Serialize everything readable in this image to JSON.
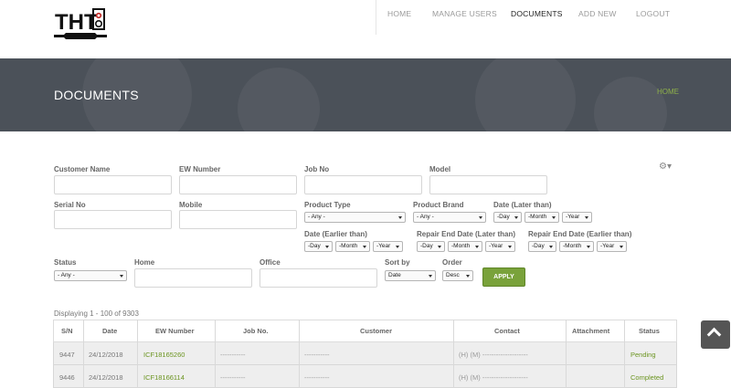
{
  "logo": {
    "text": "THT",
    "tagline": "THE HOME TECH"
  },
  "nav": {
    "home": "HOME",
    "manage_users": "MANAGE USERS",
    "documents": "DOCUMENTS",
    "add_new": "ADD NEW",
    "logout": "LOGOUT"
  },
  "hero": {
    "title": "DOCUMENTS",
    "breadcrumb": "HOME"
  },
  "filters": {
    "customer_name": "Customer Name",
    "ew_number": "EW Number",
    "job_no": "Job No",
    "model": "Model",
    "serial_no": "Serial No",
    "mobile": "Mobile",
    "product_type": {
      "label": "Product Type",
      "value": "- Any -"
    },
    "product_brand": {
      "label": "Product Brand",
      "value": "- Any -"
    },
    "date_later": {
      "label": "Date (Later than)",
      "day": "-Day",
      "month": "-Month",
      "year": "-Year"
    },
    "date_earlier": {
      "label": "Date (Earlier than)",
      "day": "-Day",
      "month": "-Month",
      "year": "-Year"
    },
    "repair_later": {
      "label": "Repair End Date (Later than)",
      "day": "-Day",
      "month": "-Month",
      "year": "-Year"
    },
    "repair_earlier": {
      "label": "Repair End Date (Earlier than)",
      "day": "-Day",
      "month": "-Month",
      "year": "-Year"
    },
    "status": {
      "label": "Status",
      "value": "- Any -"
    },
    "home": "Home",
    "office": "Office",
    "sort_by": {
      "label": "Sort by",
      "value": "Date"
    },
    "order": {
      "label": "Order",
      "value": "Desc"
    },
    "apply_label": "APPLY"
  },
  "display_text": "Displaying 1 - 100 of 9303",
  "table": {
    "headers": [
      "S/N",
      "Date",
      "EW Number",
      "Job No.",
      "Customer",
      "Contact",
      "Attachment",
      "Status"
    ],
    "rows": [
      {
        "sn": "9447",
        "date": "24/12/2018",
        "ew": "ICF18165260",
        "job": "-----------",
        "customer": "-----------",
        "contact": "(H) (M) --------------------",
        "attachment": "",
        "status": "Pending"
      },
      {
        "sn": "9446",
        "date": "24/12/2018",
        "ew": "ICF18166114",
        "job": "-----------",
        "customer": "-----------",
        "contact": "(H) (M) --------------------",
        "attachment": "",
        "status": "Completed"
      }
    ]
  },
  "icons": {
    "gear": "gear-icon",
    "scroll_top": "chevron-up-icon"
  }
}
